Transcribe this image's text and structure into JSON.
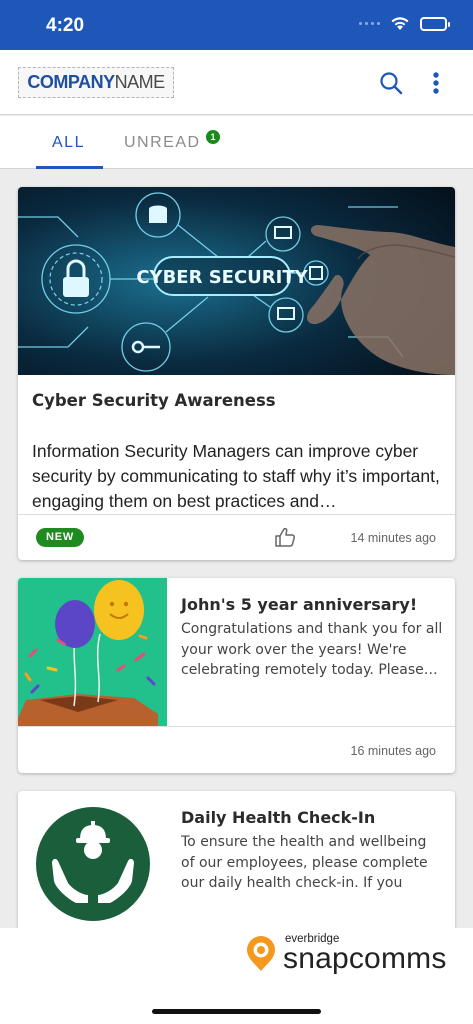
{
  "status_bar": {
    "time": "4:20",
    "icons": [
      "signal-dots-icon",
      "wifi-icon",
      "battery-icon"
    ]
  },
  "header": {
    "logo": {
      "company": "COMPANY",
      "name": "NAME"
    },
    "icons": [
      "search-icon",
      "more-vertical-icon"
    ]
  },
  "tabs": {
    "all": "ALL",
    "unread": "UNREAD",
    "unread_count": "1"
  },
  "feed": [
    {
      "title": "Cyber Security Awareness",
      "image": "cyber-security-image",
      "image_text": "CYBER SECURITY",
      "body": "Information Security Managers can improve cyber security by communicating to staff why it’s important, engaging them on best practices and…",
      "badge": "NEW",
      "like_icon": "thumbs-up-icon",
      "time": "14 minutes ago"
    },
    {
      "title": "John's 5 year anniversary!",
      "image": "balloons-celebration-image",
      "body": "Congratulations and thank you for all your work over the years! We're celebrating remotely today. Please…",
      "time": "16 minutes ago"
    },
    {
      "title": "Daily Health Check-In",
      "image": "health-worker-hands-icon",
      "body": "To ensure the health and wellbeing of our employees, please complete our daily health check-in. If you are…"
    }
  ],
  "footer": {
    "brand_small": "everbridge",
    "brand_main": "snapcomms",
    "logo_icon": "snapcomms-pin-icon"
  },
  "colors": {
    "primary": "#1f57b8",
    "badge_green": "#1a8a1a",
    "health_green": "#1b5e3b",
    "thumb_bg": "#22c08a"
  }
}
